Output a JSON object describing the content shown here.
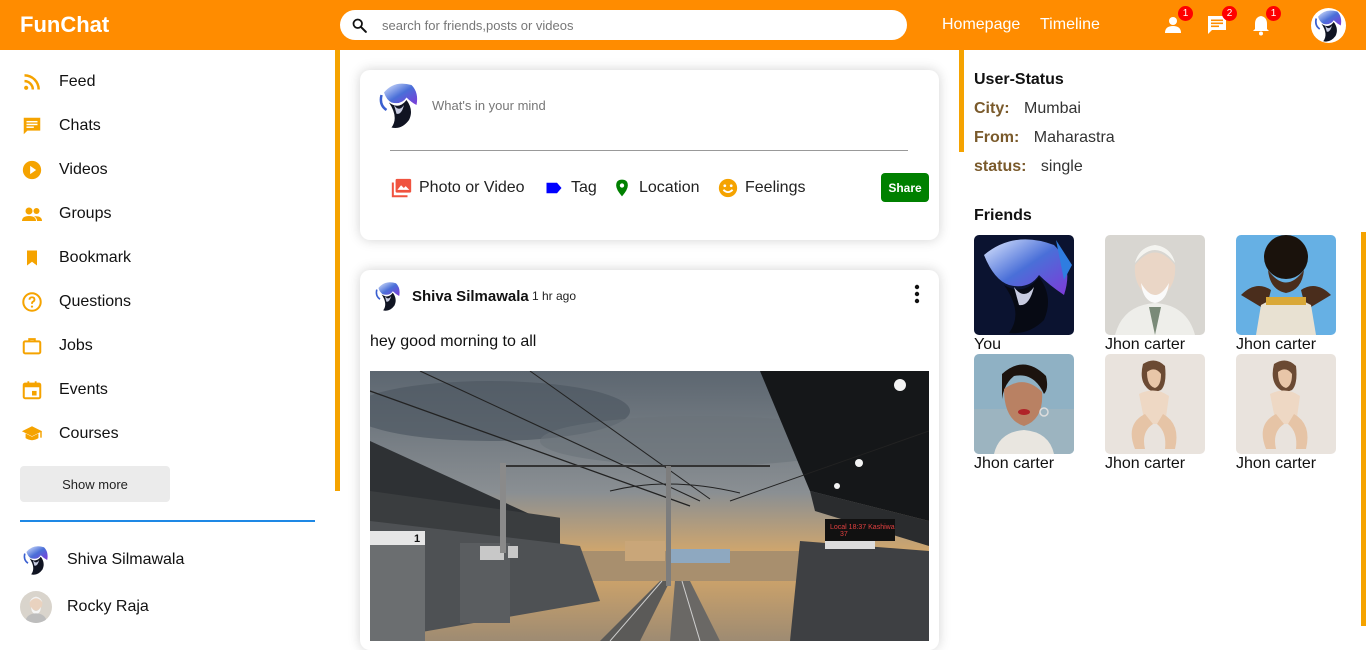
{
  "header": {
    "logo": "FunChat",
    "search_placeholder": "search for friends,posts or videos",
    "links": [
      "Homepage",
      "Timeline"
    ],
    "badges": {
      "friends": "1",
      "chat": "2",
      "notifications": "1"
    }
  },
  "sidebar": {
    "items": [
      {
        "label": "Feed",
        "icon": "rss-feed-icon"
      },
      {
        "label": "Chats",
        "icon": "chat-icon"
      },
      {
        "label": "Videos",
        "icon": "play-circle-icon"
      },
      {
        "label": "Groups",
        "icon": "group-icon"
      },
      {
        "label": "Bookmark",
        "icon": "bookmark-icon"
      },
      {
        "label": "Questions",
        "icon": "help-circle-icon"
      },
      {
        "label": "Jobs",
        "icon": "briefcase-icon"
      },
      {
        "label": "Events",
        "icon": "calendar-icon"
      },
      {
        "label": "Courses",
        "icon": "school-icon"
      }
    ],
    "show_more": "Show more",
    "friends": [
      "Shiva Silmawala",
      "Rocky Raja"
    ]
  },
  "share": {
    "placeholder": "What's in your mind",
    "options": [
      "Photo or Video",
      "Tag",
      "Location",
      "Feelings"
    ],
    "button": "Share"
  },
  "post": {
    "user": "Shiva Silmawala",
    "time": "1 hr ago",
    "text": "hey good morning to all",
    "sign_a": "1",
    "sign_b": "37"
  },
  "rightbar": {
    "status_title": "User-Status",
    "info": [
      {
        "key": "City:",
        "value": "Mumbai"
      },
      {
        "key": "From:",
        "value": "Maharastra"
      },
      {
        "key": "status:",
        "value": "single"
      }
    ],
    "friends_title": "Friends",
    "friends": [
      "You",
      "Jhon carter",
      "Jhon carter",
      "Jhon carter",
      "Jhon carter",
      "Jhon carter"
    ]
  },
  "colors": {
    "accent": "#ff8c00",
    "side_icon": "#f5a300",
    "share_button": "#008000",
    "badge": "#ff0000",
    "divider": "#1e88e5"
  }
}
